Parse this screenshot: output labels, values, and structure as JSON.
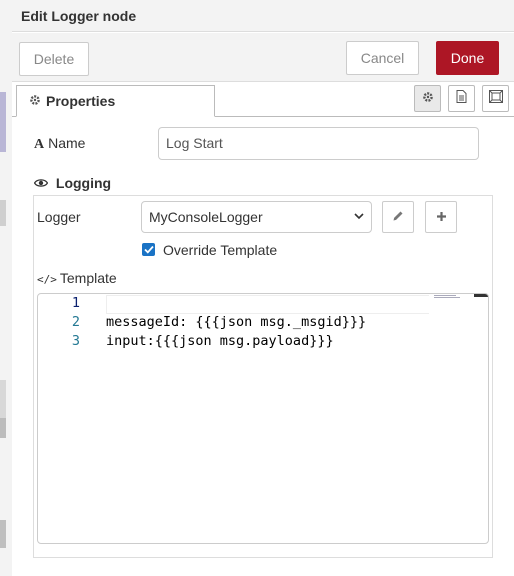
{
  "header": {
    "title": "Edit Logger node"
  },
  "toolbar": {
    "delete_label": "Delete",
    "cancel_label": "Cancel",
    "done_label": "Done"
  },
  "tabs": {
    "properties_label": "Properties"
  },
  "form": {
    "name_label": "Name",
    "name_value": "Log Start",
    "logging_title": "Logging",
    "logger_label": "Logger",
    "logger_selected": "MyConsoleLogger",
    "override_label": "Override Template",
    "override_checked": true,
    "template_label": "Template"
  },
  "editor": {
    "line_numbers": [
      "1",
      "2",
      "3"
    ],
    "lines": [
      "",
      "messageId: {{{json msg._msgid}}}",
      "input:{{{json msg.payload}}}"
    ]
  },
  "colors": {
    "done_button": "#ad1625",
    "checkbox": "#1a73c5",
    "line_number": "#237893"
  }
}
